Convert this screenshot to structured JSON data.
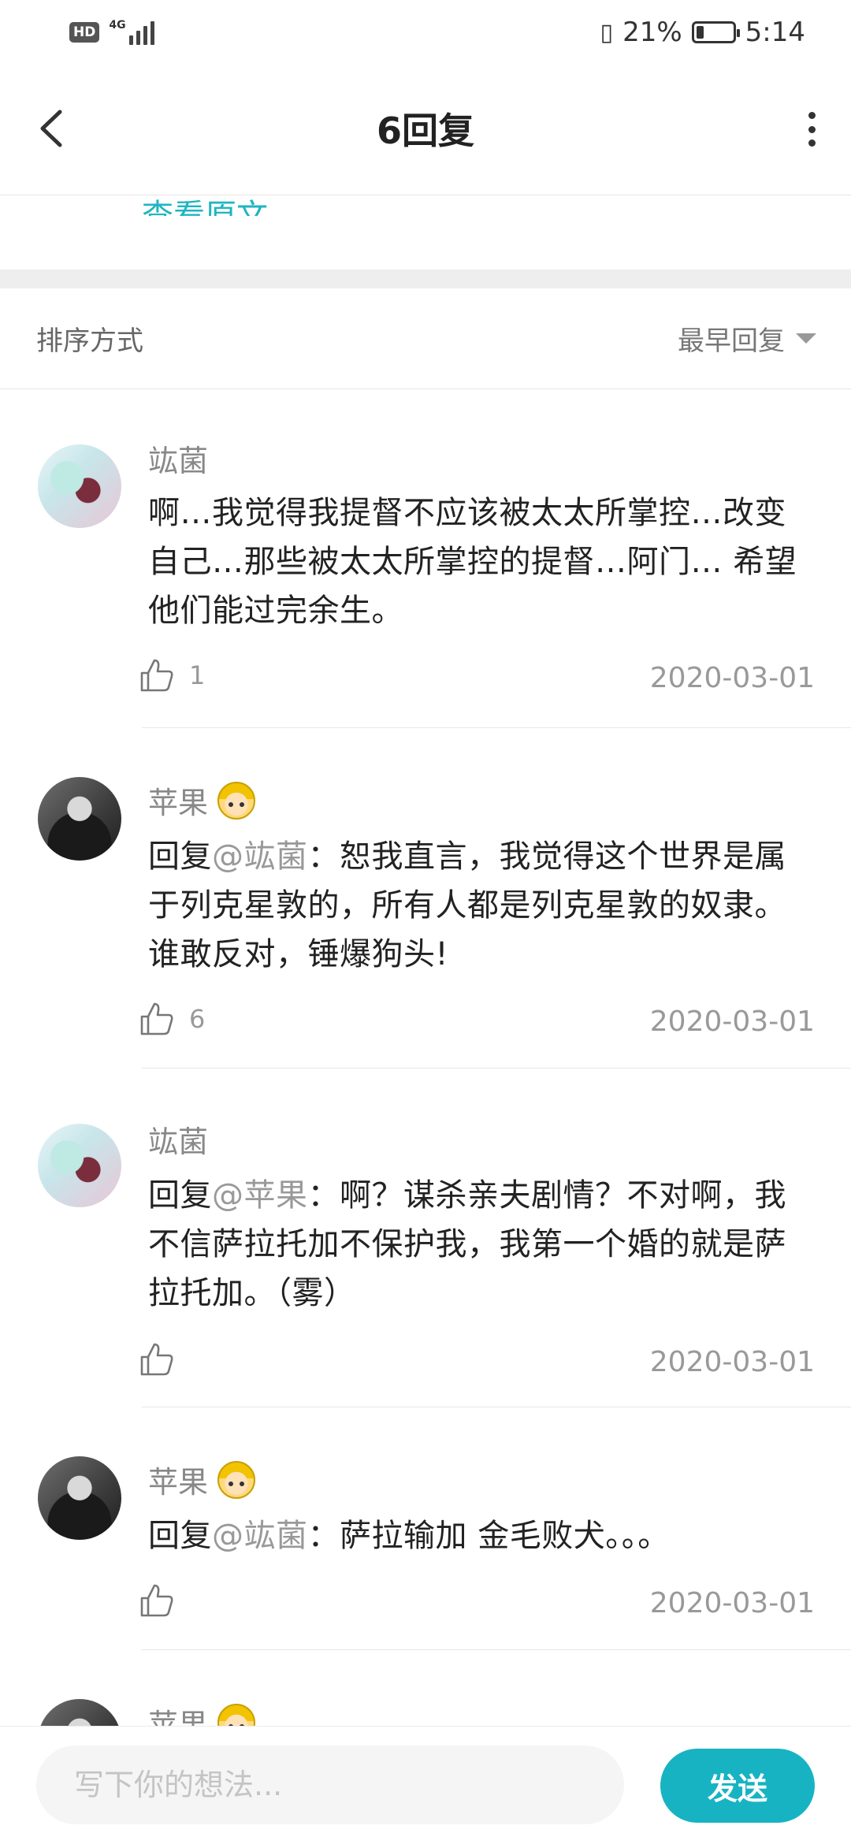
{
  "status_bar": {
    "network": "4G",
    "hd": "HD",
    "battery": "21%",
    "time": "5:14",
    "battery_level": 0.21
  },
  "header": {
    "title": "6回复"
  },
  "original_link": "查看原文",
  "sort": {
    "label": "排序方式",
    "selected": "最早回复"
  },
  "replies": [
    {
      "author": "竑菌",
      "prefix": "",
      "mention": "",
      "text": "啊…我觉得我提督不应该被太太所掌控…改变自己…那些被太太所掌控的提督…阿门… 希望他们能过完余生。",
      "likes": "1",
      "date": "2020-03-01",
      "avatar": "anime"
    },
    {
      "author": "苹果",
      "prefix": "回复",
      "mention": "@竑菌",
      "text": "：恕我直言，我觉得这个世界是属于列克星敦的，所有人都是列克星敦的奴隶。谁敢反对，锤爆狗头!",
      "likes": "6",
      "date": "2020-03-01",
      "avatar": "dark"
    },
    {
      "author": "竑菌",
      "prefix": "回复",
      "mention": "@苹果",
      "text": "：啊？谋杀亲夫剧情？不对啊，我不信萨拉托加不保护我，我第一个婚的就是萨拉托加。（雾）",
      "likes": "",
      "date": "2020-03-01",
      "avatar": "anime"
    },
    {
      "author": "苹果",
      "prefix": "回复",
      "mention": "@竑菌",
      "text": "：萨拉输加 金毛败犬。。。",
      "likes": "",
      "date": "2020-03-01",
      "avatar": "dark"
    },
    {
      "author": "苹果",
      "prefix": "",
      "mention": "",
      "text": "",
      "likes": "",
      "date": "",
      "avatar": "dark"
    }
  ],
  "composer": {
    "placeholder": "写下你的想法...",
    "send_label": "发送"
  },
  "colors": {
    "accent": "#17b3c3",
    "link": "#1fb5c1"
  }
}
